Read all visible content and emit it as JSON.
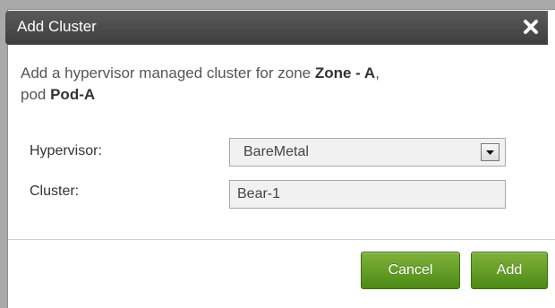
{
  "dialog": {
    "title": "Add Cluster",
    "description": {
      "prefix": "Add a hypervisor managed cluster for zone ",
      "zone": "Zone - A",
      "middle": ",",
      "pod_prefix": "pod ",
      "pod": "Pod-A"
    },
    "fields": {
      "hypervisor": {
        "label": "Hypervisor:",
        "value": "BareMetal"
      },
      "cluster": {
        "label": "Cluster:",
        "value": "Bear-1"
      }
    },
    "buttons": {
      "cancel": "Cancel",
      "add": "Add"
    }
  },
  "colors": {
    "titlebar": "#4a4a4a",
    "button_green": "#5a9a1f",
    "background": "#a9a9a9"
  }
}
